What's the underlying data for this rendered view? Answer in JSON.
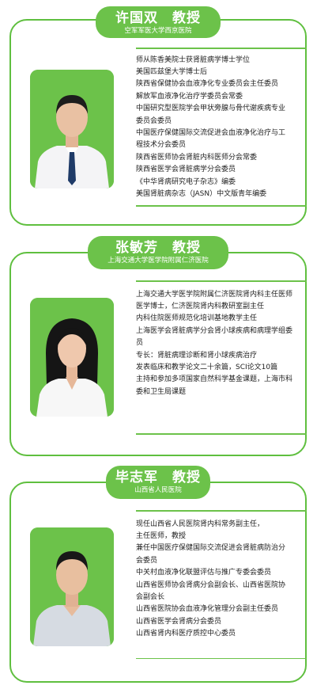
{
  "colors": {
    "accent": "#6cc24a",
    "border": "#5fbf3f"
  },
  "doctors": [
    {
      "name": "许国双　教授",
      "org": "空军军医大学西京医院",
      "bio": [
        "师从陈香美院士获肾脏病学博士学位",
        "美国匹兹堡大学博士后",
        "陕西省保健协会血液净化专业委员会主任委员",
        "解放军血液净化治疗学委员会常委",
        "中国研究型医院学会甲状旁腺与骨代谢疾病专业",
        "委员会委员",
        "中国医疗保健国际交流促进会血液净化治疗与工",
        "程技术分会委员",
        "陕西省医师协会肾脏内科医师分会常委",
        "陕西省医学会肾脏病学分会委员",
        "《中华肾病研究电子杂志》编委",
        "美国肾脏病杂志（JASN）中文版青年编委"
      ]
    },
    {
      "name": "张敏芳　教授",
      "org": "上海交通大学医学院附属仁济医院",
      "bio": [
        "上海交通大学医学院附属仁济医院肾内科主任医师",
        "医学博士，仁济医院肾内科教研室副主任",
        "内科住院医师规范化培训基地教学主任",
        "上海医学会肾脏病学分会肾小球疾病和病理学组委",
        "员",
        "专长：肾脏病理诊断和肾小球疾病治疗",
        "发表临床和教学论文二十余篇，SCI论文10篇",
        "主持和参加多项国家自然科学基金课题，上海市科",
        "委和卫生局课题"
      ]
    },
    {
      "name": "毕志军　教授",
      "org": "山西省人民医院",
      "bio": [
        "现任山西省人民医院肾内科常务副主任，",
        "主任医师，教授",
        "兼任中国医疗保健国际交流促进会肾脏病防治分",
        "会委员",
        "中关村血液净化联盟评估与推广专委会委员",
        "山西省医师协会肾病分会副会长、山西省医院协",
        "会副会长",
        "山西省医院协会血液净化管理分会副主任委员",
        "山西省医学会肾病分会委员",
        "山西省肾内科医疗质控中心委员"
      ]
    }
  ]
}
